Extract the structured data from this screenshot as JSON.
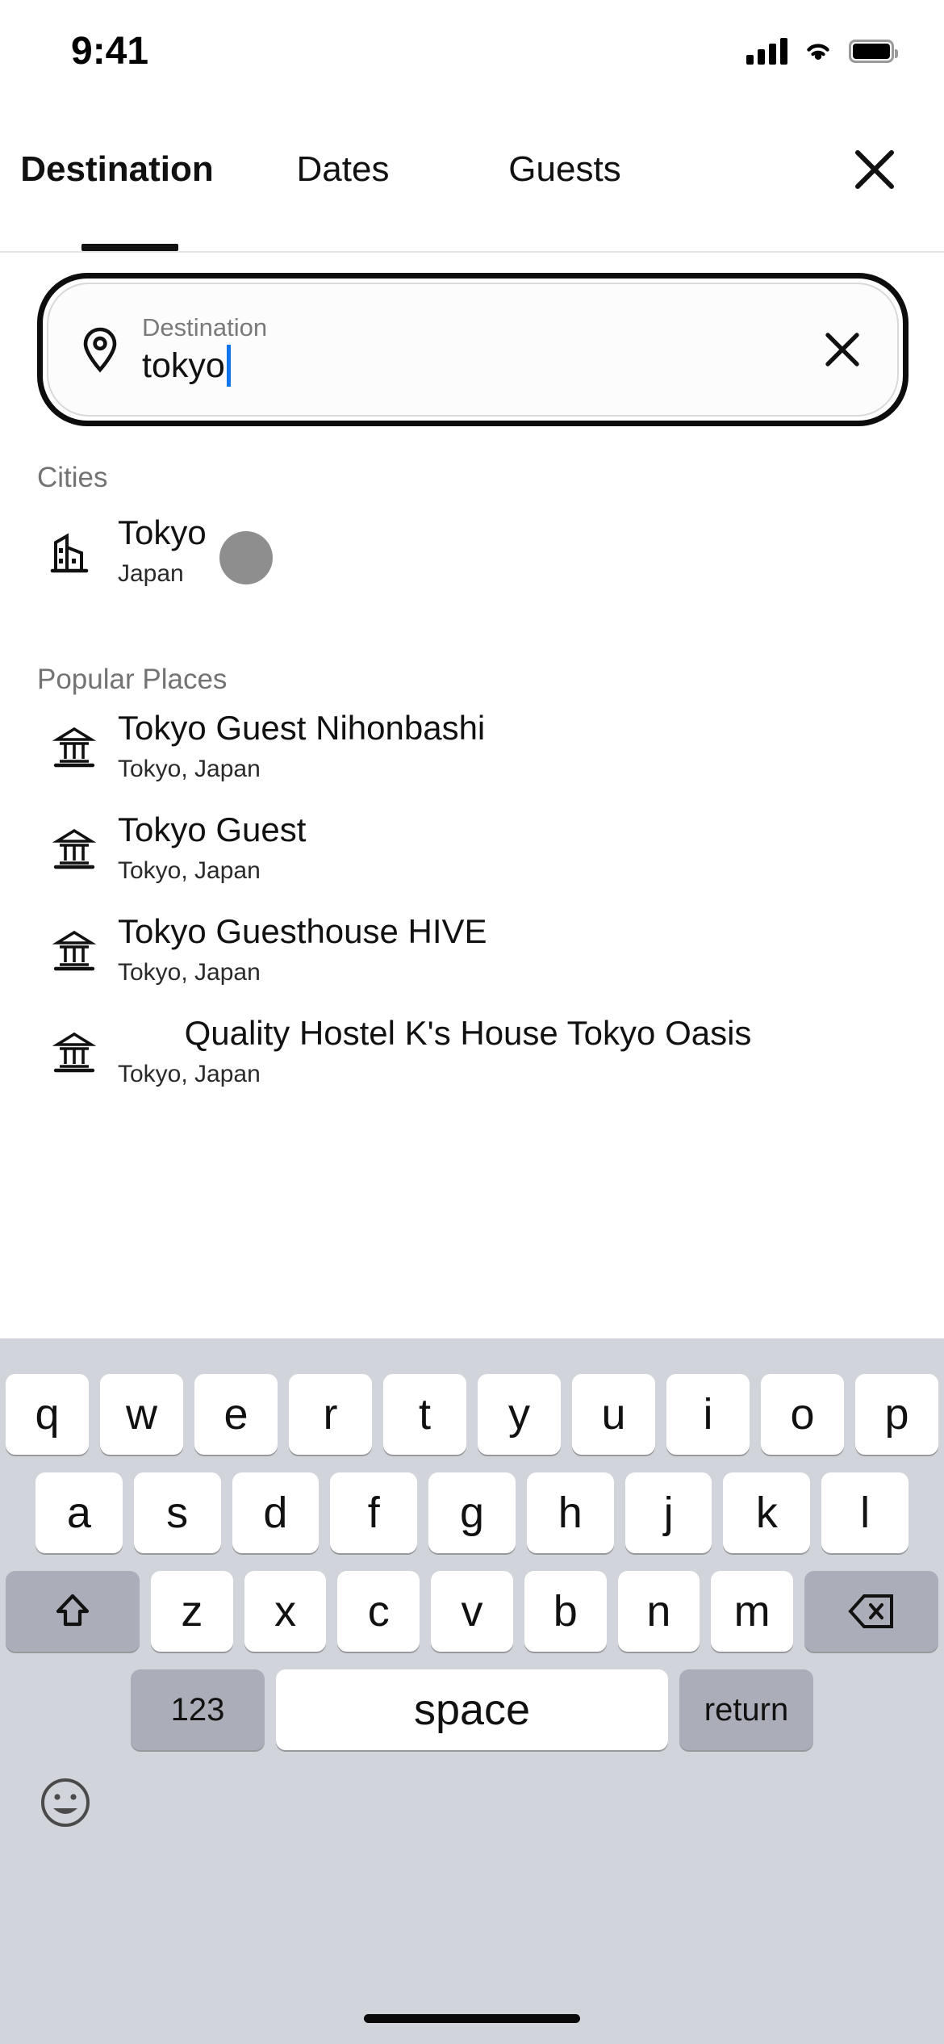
{
  "statusbar": {
    "time": "9:41",
    "signal_icon": "cellular-signal-icon",
    "wifi_icon": "wifi-icon",
    "battery_icon": "battery-full-icon"
  },
  "tabbar": {
    "tabs": [
      {
        "label": "Destination",
        "active": true
      },
      {
        "label": "Dates",
        "active": false
      },
      {
        "label": "Guests",
        "active": false
      }
    ],
    "close_icon": "close-icon"
  },
  "search": {
    "label": "Destination",
    "value": "tokyo",
    "placeholder": "Destination",
    "pin_icon": "location-pin-icon",
    "clear_icon": "clear-icon",
    "caret_color": "#1374f0",
    "focus_ring_color": "#0d0d0d"
  },
  "results": {
    "cities_header": "Cities",
    "cities": [
      {
        "title": "Tokyo",
        "subtitle": "Japan",
        "icon": "city-buildings-icon",
        "tap_indicator": true
      }
    ],
    "popular_header": "Popular Places",
    "popular_places": [
      {
        "title": "Tokyo Guest Nihonbashi",
        "subtitle": "Tokyo, Japan",
        "icon": "landmark-icon"
      },
      {
        "title": "Tokyo Guest",
        "subtitle": "Tokyo, Japan",
        "icon": "landmark-icon"
      },
      {
        "title": "Tokyo Guesthouse HIVE",
        "subtitle": "Tokyo, Japan",
        "icon": "landmark-icon"
      },
      {
        "title": "Quality Hostel K's House Tokyo Oasis",
        "subtitle": "Tokyo, Japan",
        "icon": "landmark-icon"
      }
    ]
  },
  "keyboard": {
    "row1": [
      "q",
      "w",
      "e",
      "r",
      "t",
      "y",
      "u",
      "i",
      "o",
      "p"
    ],
    "row2": [
      "a",
      "s",
      "d",
      "f",
      "g",
      "h",
      "j",
      "k",
      "l"
    ],
    "row3": [
      "z",
      "x",
      "c",
      "v",
      "b",
      "n",
      "m"
    ],
    "shift_icon": "shift-icon",
    "backspace_icon": "backspace-icon",
    "numeric_label": "123",
    "space_label": "space",
    "return_label": "return",
    "emoji_icon": "emoji-icon",
    "bg_color": "#d1d4da",
    "key_color": "#ffffff",
    "mod_key_color": "#abaeb8"
  }
}
